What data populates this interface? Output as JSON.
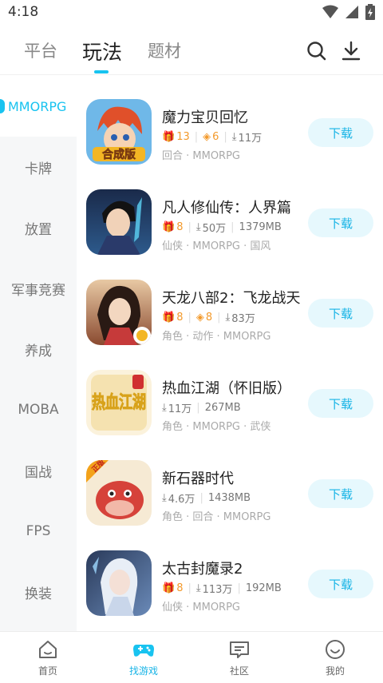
{
  "status_bar": {
    "time": "4:18"
  },
  "header": {
    "tabs": [
      {
        "label": "平台",
        "active": false
      },
      {
        "label": "玩法",
        "active": true
      },
      {
        "label": "题材",
        "active": false
      }
    ],
    "icons": [
      "search-icon",
      "download-icon"
    ]
  },
  "sidebar": {
    "items": [
      {
        "label": "MMORPG",
        "active": true
      },
      {
        "label": "卡牌",
        "active": false
      },
      {
        "label": "放置",
        "active": false
      },
      {
        "label": "军事竞赛",
        "active": false
      },
      {
        "label": "养成",
        "active": false
      },
      {
        "label": "MOBA",
        "active": false
      },
      {
        "label": "国战",
        "active": false
      },
      {
        "label": "FPS",
        "active": false
      },
      {
        "label": "换装",
        "active": false
      }
    ]
  },
  "games": [
    {
      "title": "魔力宝贝回忆",
      "gift": "13",
      "coupon": "6",
      "downloads": "11万",
      "size": "",
      "tags": "回合 · MMORPG",
      "button": "下载",
      "icon": "game-icon-molibaobei"
    },
    {
      "title": "凡人修仙传：人界篇",
      "gift": "8",
      "coupon": "",
      "downloads": "50万",
      "size": "1379MB",
      "tags": "仙侠 · MMORPG · 国风",
      "button": "下载",
      "icon": "game-icon-fanren"
    },
    {
      "title": "天龙八部2：飞龙战天",
      "gift": "8",
      "coupon": "8",
      "downloads": "83万",
      "size": "",
      "tags": "角色 · 动作 · MMORPG",
      "button": "下载",
      "icon": "game-icon-tianlong"
    },
    {
      "title": "热血江湖（怀旧版）",
      "gift": "",
      "coupon": "",
      "downloads": "11万",
      "size": "267MB",
      "tags": "角色 · MMORPG · 武侠",
      "button": "下载",
      "icon": "game-icon-rexue"
    },
    {
      "title": "新石器时代",
      "gift": "",
      "coupon": "",
      "downloads": "4.6万",
      "size": "1438MB",
      "tags": "角色 · 回合 · MMORPG",
      "button": "下载",
      "icon": "game-icon-xinshiqi"
    },
    {
      "title": "太古封魔录2",
      "gift": "8",
      "coupon": "",
      "downloads": "113万",
      "size": "192MB",
      "tags": "仙侠 · MMORPG",
      "button": "下载",
      "icon": "game-icon-taigu"
    }
  ],
  "icon_texts": {
    "hecheng": "合成版",
    "rexue": "热血江湖",
    "zhengban": "正版"
  },
  "bottom_nav": [
    {
      "label": "首页",
      "icon": "home-icon",
      "active": false
    },
    {
      "label": "找游戏",
      "icon": "gamepad-icon",
      "active": true
    },
    {
      "label": "社区",
      "icon": "community-icon",
      "active": false
    },
    {
      "label": "我的",
      "icon": "profile-icon",
      "active": false
    }
  ],
  "colors": {
    "accent": "#18c3f0",
    "gift": "#f39a2c",
    "button_bg": "#e6f8fd"
  }
}
